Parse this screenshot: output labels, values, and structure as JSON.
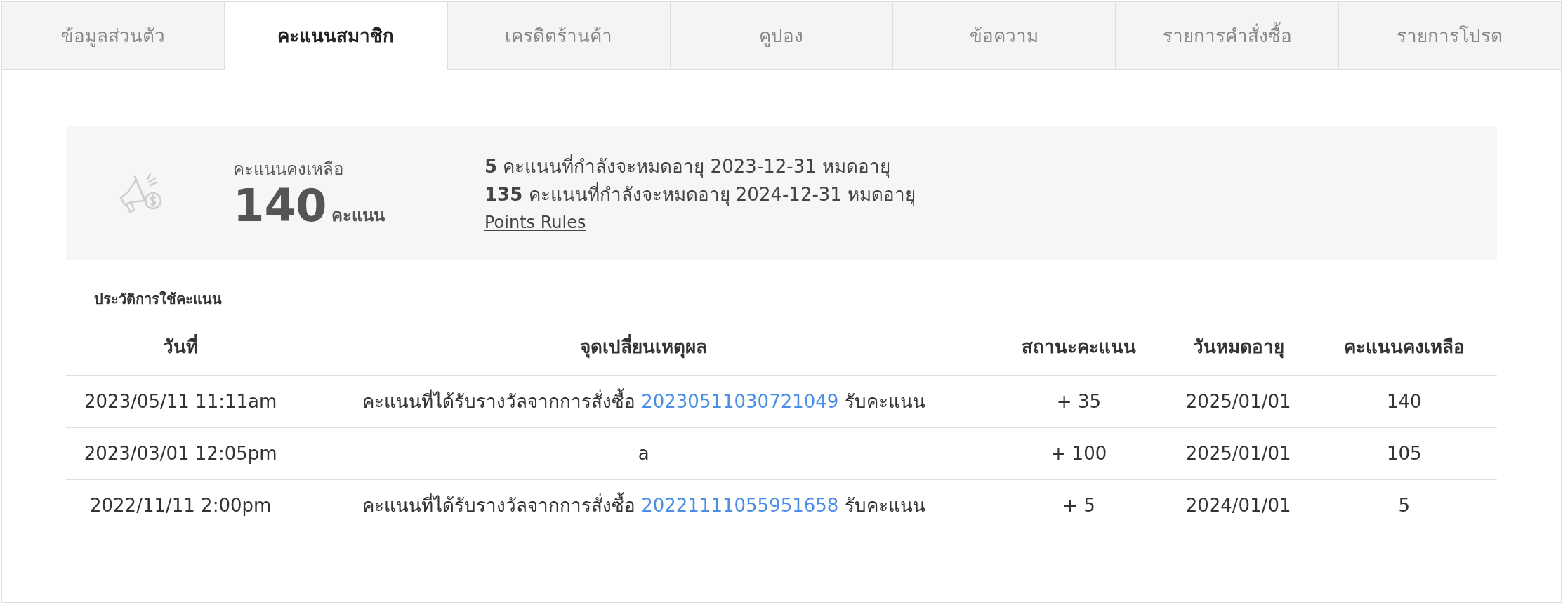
{
  "tabs": [
    {
      "label": "ข้อมูลส่วนตัว",
      "selected": false
    },
    {
      "label": "คะแนนสมาชิก",
      "selected": true
    },
    {
      "label": "เครดิตร้านค้า",
      "selected": false
    },
    {
      "label": "คูปอง",
      "selected": false
    },
    {
      "label": "ข้อความ",
      "selected": false
    },
    {
      "label": "รายการคำสั่งซื้อ",
      "selected": false
    },
    {
      "label": "รายการโปรด",
      "selected": false
    }
  ],
  "points_summary": {
    "label": "คะแนนคงเหลือ",
    "points": "140",
    "unit": "คะแนน",
    "expiring": [
      "**5** คะแนนที่กำลังจะหมดอายุ 2023-12-31 หมดอายุ",
      "**135** คะแนนที่กำลังจะหมดอายุ 2024-12-31 หมดอายุ"
    ],
    "rules_link": "Points Rules"
  },
  "history": {
    "title": "ประวัติการใช้คะแนน",
    "columns": [
      "วันที่",
      "จุดเปลี่ยนเหตุผล",
      "สถานะคะแนน",
      "วันหมดอายุ",
      "คะแนนคงเหลือ"
    ],
    "rows": [
      {
        "date": "2023/05/11 11:11am",
        "reason": [
          {
            "kind": "text",
            "text": "คะแนนที่ได้รับรางวัลจากการสั่งซื้อ"
          },
          {
            "kind": "link",
            "text": "20230511030721049"
          },
          {
            "kind": "text",
            "text": "รับคะแนน"
          }
        ],
        "change": "+ 35",
        "expiry": "2025/01/01",
        "balance": "140"
      },
      {
        "date": "2023/03/01 12:05pm",
        "reason": [
          {
            "kind": "text",
            "text": "a"
          }
        ],
        "change": "+ 100",
        "expiry": "2025/01/01",
        "balance": "105"
      },
      {
        "date": "2022/11/11 2:00pm",
        "reason": [
          {
            "kind": "text",
            "text": "คะแนนที่ได้รับรางวัลจากการสั่งซื้อ"
          },
          {
            "kind": "link",
            "text": "20221111055951658"
          },
          {
            "kind": "text",
            "text": "รับคะแนน"
          }
        ],
        "change": "+ 5",
        "expiry": "2024/01/01",
        "balance": "5"
      }
    ]
  }
}
